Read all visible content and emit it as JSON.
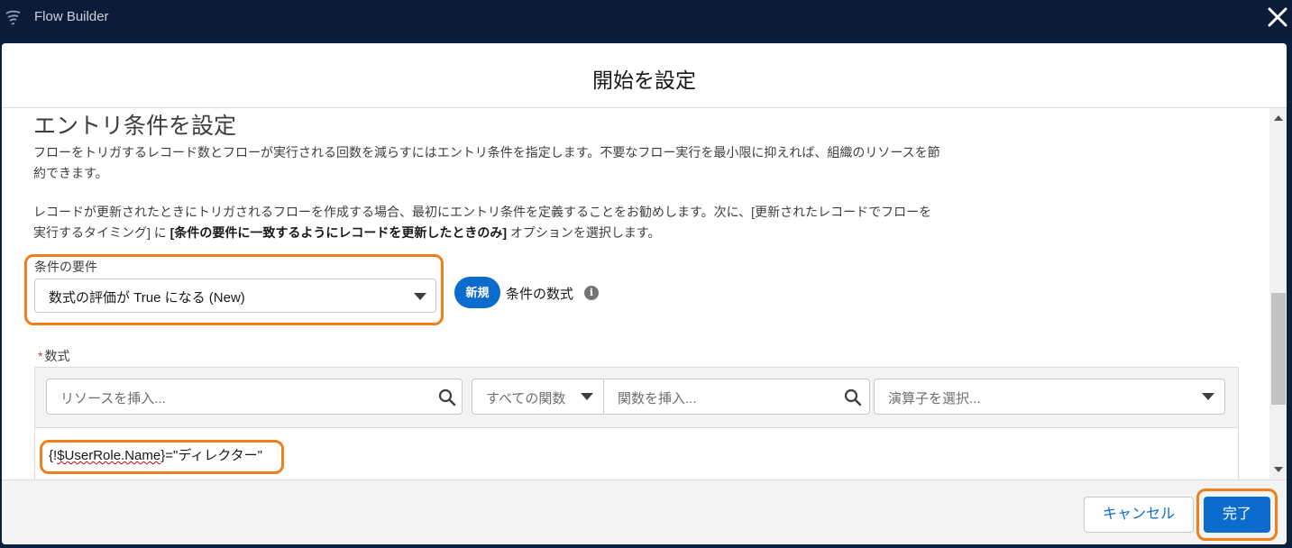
{
  "app": {
    "title": "Flow Builder",
    "icon": "flow-builder-icon",
    "close_icon": "close-icon"
  },
  "modal": {
    "title": "開始を設定",
    "section_title": "エントリ条件を設定",
    "para1": "フローをトリガするレコード数とフローが実行される回数を減らすにはエントリ条件を指定します。不要なフロー実行を最小限に抑えれば、組織のリソースを節約できます。",
    "para2_pre": "レコードが更新されたときにトリガされるフローを作成する場合、最初にエントリ条件を定義することをお勧めします。次に、[更新されたレコードでフローを実行するタイミング] に ",
    "para2_bold": "[条件の要件に一致するようにレコードを更新したときのみ]",
    "para2_post": " オプションを選択します。"
  },
  "condition_requirement": {
    "label": "条件の要件",
    "value": "数式の評価が True になる (New)",
    "new_badge": "新規",
    "formula_type_label": "条件の数式",
    "info_icon": "info-icon"
  },
  "formula": {
    "required_marker": "*",
    "label": "数式",
    "resource_placeholder": "リソースを挿入...",
    "function_category": "すべての関数",
    "function_placeholder": "関数を挿入...",
    "operator_placeholder": "演算子を選択...",
    "text_open": "{!",
    "text_var": "$UserRole.Name",
    "text_close": "}=\"ディレクター\""
  },
  "footer": {
    "cancel_label": "キャンセル",
    "done_label": "完了"
  },
  "colors": {
    "topbar": "#0c1c38",
    "brand_blue": "#0b6cce",
    "highlight_orange": "#ef7f1a",
    "footer_bg": "#f3f3f3"
  }
}
